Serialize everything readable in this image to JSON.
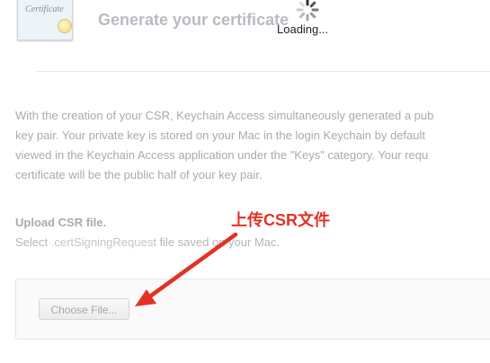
{
  "header": {
    "icon_text": "Certificate",
    "title": "Generate your certificate",
    "loading": "Loading..."
  },
  "intro_lines": [
    "With the creation of your CSR, Keychain Access simultaneously generated a pub",
    "key pair. Your private key is stored on your Mac in the login Keychain by default",
    "viewed in the Keychain Access application under the \"Keys\" category. Your requ",
    "certificate will be the public half of your key pair."
  ],
  "upload": {
    "title": "Upload CSR file.",
    "desc_prefix": "Select ",
    "desc_code": ".certSigningRequest",
    "desc_suffix": " file saved on your Mac.",
    "button_label": "Choose File..."
  },
  "annotation": {
    "text": "上传CSR文件",
    "color": "#e33126"
  }
}
